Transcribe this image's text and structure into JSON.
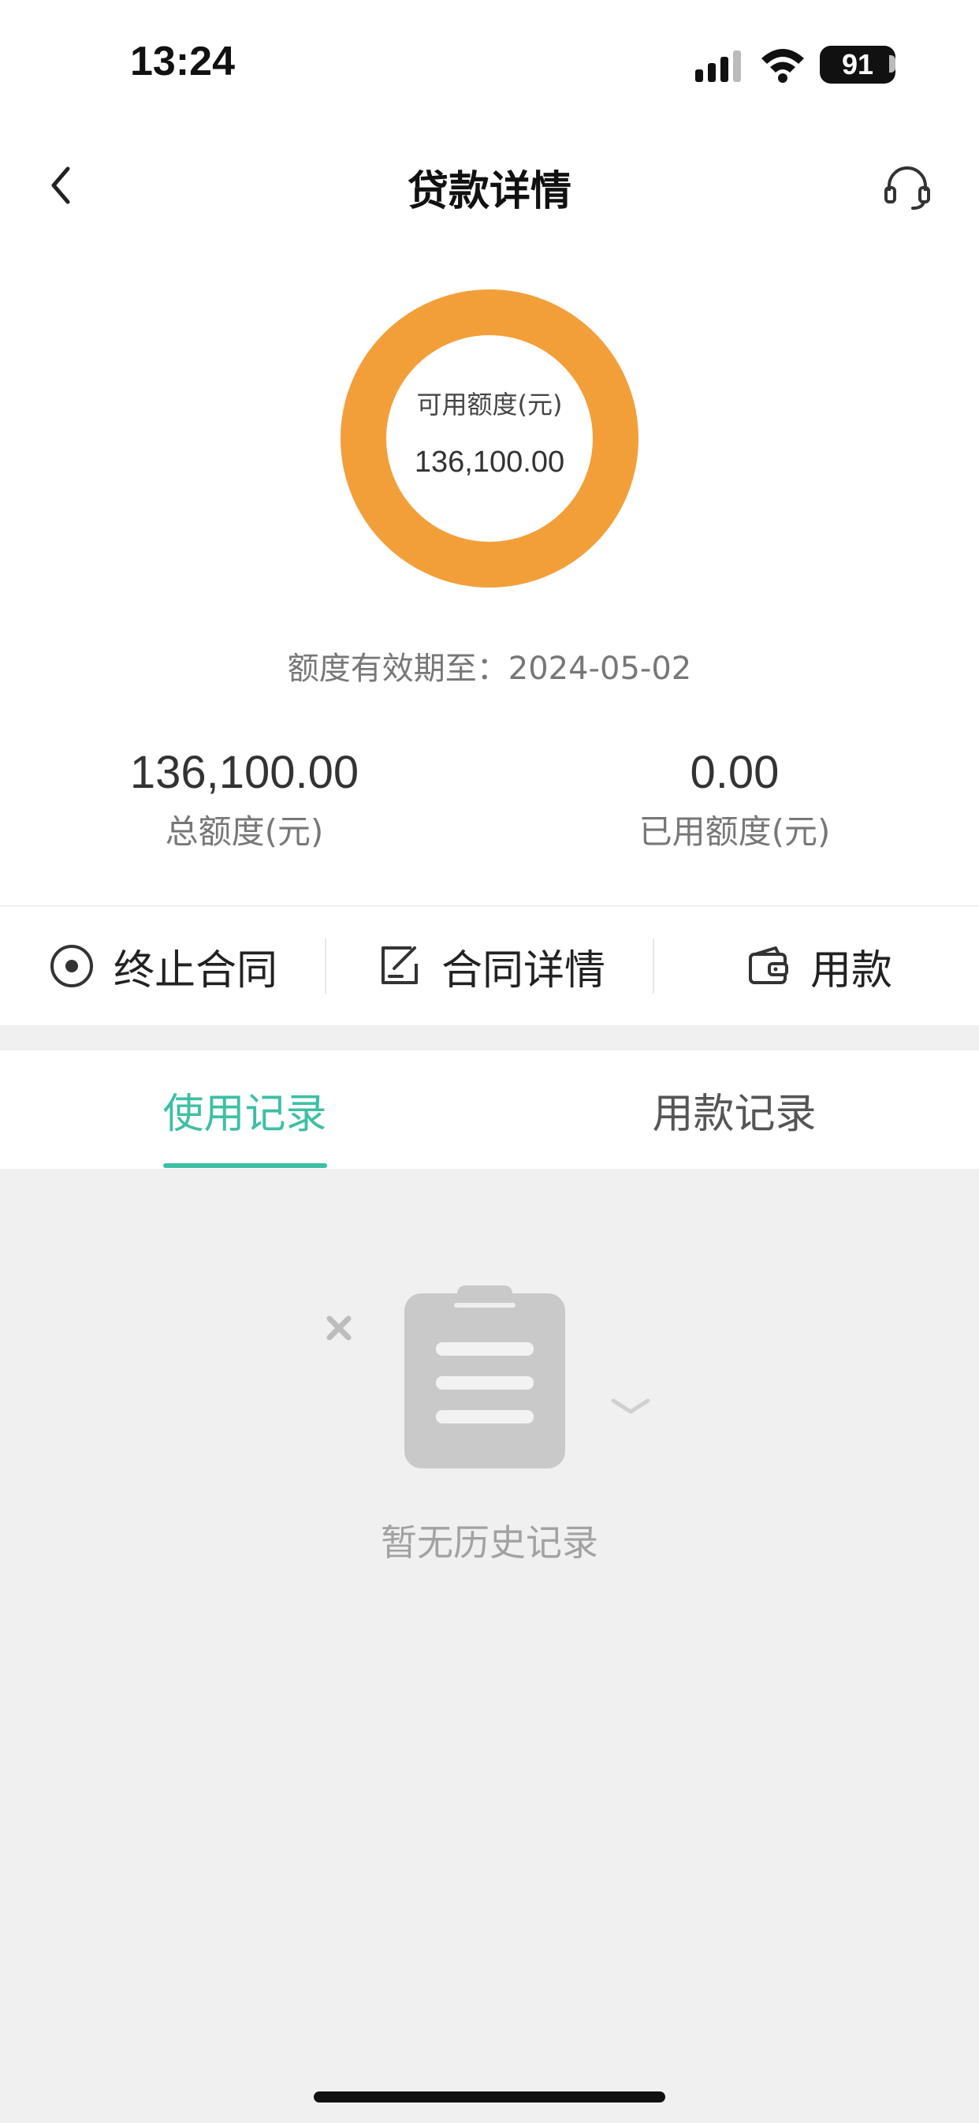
{
  "status_bar": {
    "time": "13:24",
    "battery": "91"
  },
  "nav": {
    "title": "贷款详情"
  },
  "donut": {
    "label": "可用额度(元)",
    "value": "136,100.00",
    "available_fraction": 1.0,
    "color": "#f29f3a"
  },
  "validity": "额度有效期至：2024-05-02",
  "stats": {
    "total_value": "136,100.00",
    "total_label": "总额度(元)",
    "used_value": "0.00",
    "used_label": "已用额度(元)"
  },
  "actions": {
    "terminate": "终止合同",
    "contract_details": "合同详情",
    "drawdown": "用款"
  },
  "tabs": {
    "usage_records": "使用记录",
    "loan_records": "用款记录",
    "active_color": "#3ebfa3"
  },
  "empty_state": {
    "text": "暂无历史记录"
  },
  "icons": {
    "back": "back-icon",
    "support": "headset-icon",
    "terminate": "stop-circle-icon",
    "contract": "edit-document-icon",
    "drawdown": "wallet-icon",
    "empty": "clipboard-icon"
  }
}
